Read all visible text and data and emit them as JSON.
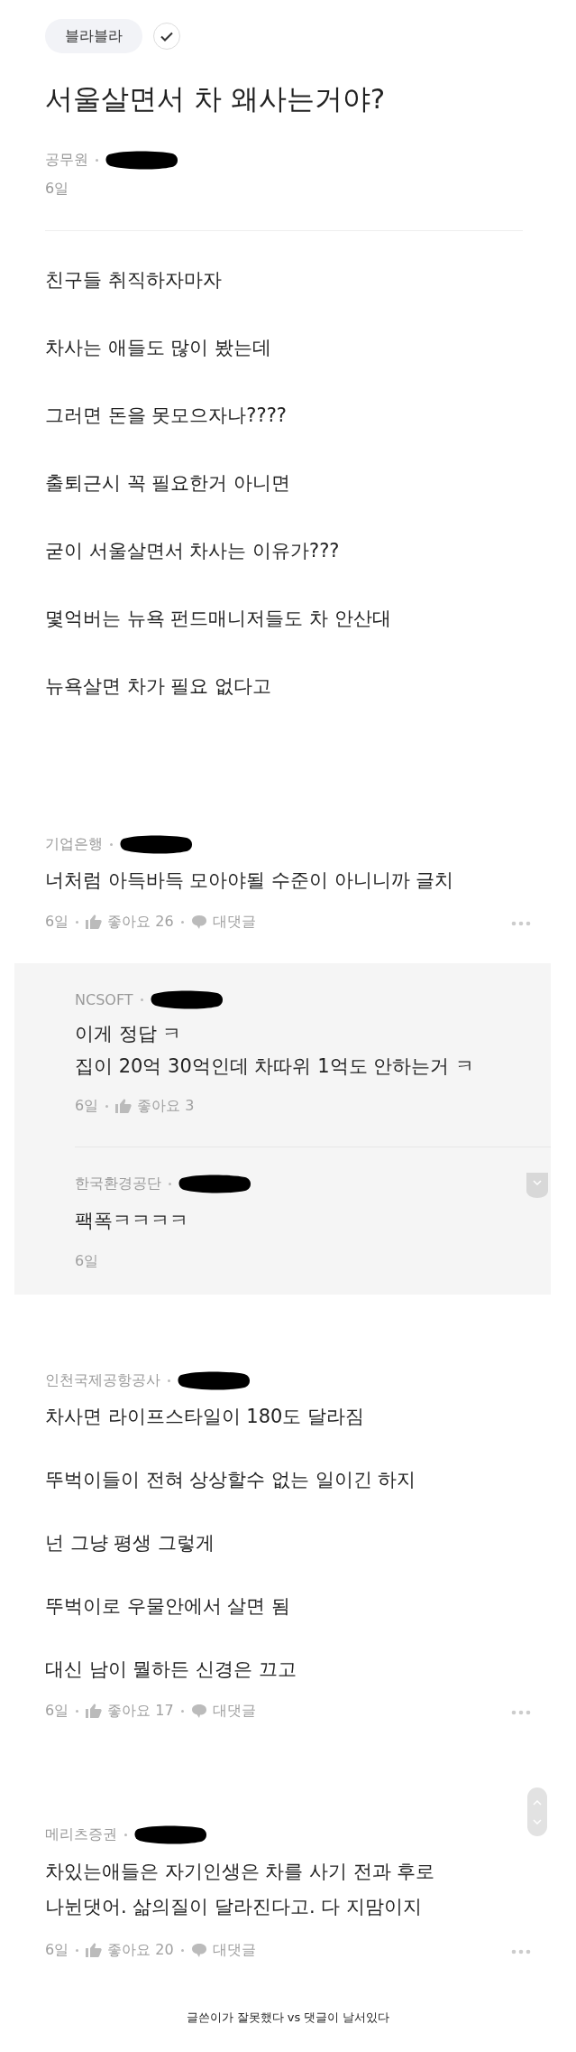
{
  "tag": {
    "label": "블라블라",
    "verified": true
  },
  "post": {
    "title": "서울살면서 차 왜사는거야?",
    "author": {
      "company": "공무원",
      "redacted": true
    },
    "time": "6일",
    "body": [
      "친구들 취직하자마자",
      "차사는 애들도 많이 봤는데",
      "그러면 돈을 못모으자나????",
      "출퇴근시 꼭 필요한거 아니면",
      "굳이 서울살면서 차사는 이유가???",
      "몇억버는 뉴욕 펀드매니저들도 차 안산대",
      "뉴욕살면 차가 필요 없다고"
    ]
  },
  "comments": [
    {
      "company": "기업은행",
      "redacted": true,
      "blank_lines": false,
      "lines": [
        "너처럼 아득바득 모아야될 수준이 아니니까 글치"
      ],
      "time": "6일",
      "likes": "좋아요 26",
      "reply_label": "대댓글",
      "replies": [
        {
          "company": "NCSOFT",
          "redacted": true,
          "lines": [
            "이게 정답 ㅋ",
            "집이 20억 30억인데 차따위 1억도 안하는거 ㅋ"
          ],
          "time": "6일",
          "likes": "좋아요 3"
        },
        {
          "company": "한국환경공단",
          "redacted": true,
          "lines": [
            "팩폭ㅋㅋㅋㅋ"
          ],
          "time": "6일"
        }
      ]
    },
    {
      "company": "인천국제공항공사",
      "redacted": true,
      "blank_lines": true,
      "lines": [
        "차사면 라이프스타일이 180도 달라짐",
        "뚜벅이들이 전혀 상상할수 없는 일이긴 하지",
        "넌 그냥 평생 그렇게",
        "뚜벅이로 우물안에서 살면 됨",
        "대신 남이 뭘하든 신경은 끄고"
      ],
      "time": "6일",
      "likes": "좋아요 17",
      "reply_label": "대댓글"
    },
    {
      "company": "메리츠증권",
      "redacted": true,
      "blank_lines": false,
      "lines": [
        "차있는애들은 자기인생은 차를 사기 전과 후로",
        "나뉜댓어. 삶의질이 달라진다고. 다 지맘이지"
      ],
      "time": "6일",
      "likes": "좋아요 20",
      "reply_label": "대댓글"
    }
  ],
  "caption": "글쓴이가 잘못했다 vs 댓글이 날서있다"
}
